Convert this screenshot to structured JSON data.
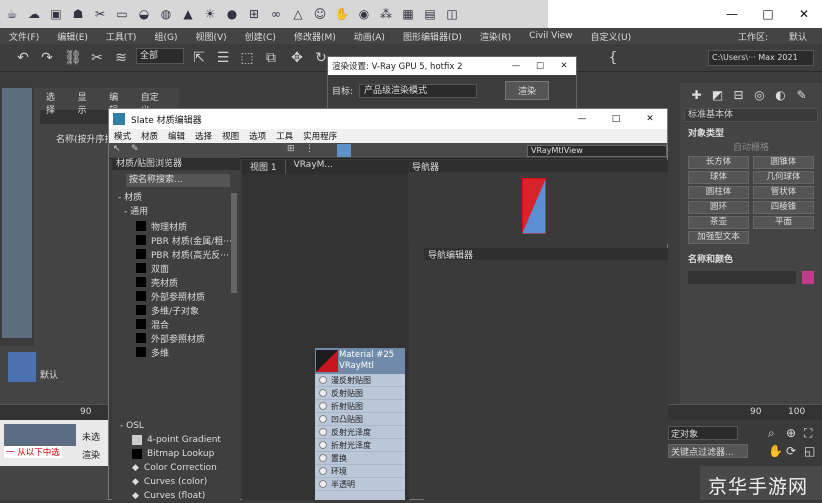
{
  "window": {
    "title": "工作区: 默认",
    "min": "—",
    "max": "□",
    "close": "✕"
  },
  "menu": [
    "文件(F)",
    "编辑(E)",
    "工具(T)",
    "组(G)",
    "视图(V)",
    "创建(C)",
    "修改器(M)",
    "动画(A)",
    "图形编辑器(D)",
    "渲染(R)",
    "Civil View",
    "自定义(U)"
  ],
  "workspace": {
    "label": "工作区:",
    "value": "默认",
    "path": "C:\\Users\\··· Max 2021"
  },
  "toolbar": {
    "filter": "全部",
    "brace": "{"
  },
  "left_panel": {
    "tabs": [
      "选择",
      "显示",
      "编辑",
      "自定义"
    ],
    "name_col": "名称(按升序排",
    "default": "默认"
  },
  "render_dialog": {
    "title": "渲染设置: V-Ray GPU 5, hotfix 2",
    "target_label": "目标:",
    "target_value": "产品级渲染模式",
    "render_btn": "渲染"
  },
  "slate": {
    "title": "Slate 材质编辑器",
    "menu": [
      "模式",
      "材质",
      "编辑",
      "选择",
      "视图",
      "选项",
      "工具",
      "实用程序"
    ],
    "view_select": "VRayMtlView"
  },
  "browser": {
    "title": "材质/贴图浏览器",
    "search": "按名称搜索...",
    "cat_material": "- 材质",
    "cat_general": "- 通用",
    "items": [
      "物理材质",
      "PBR 材质(金属/粗···",
      "PBR 材质(高光反···",
      "双面",
      "壳材质",
      "外部参照材质",
      "多维/子对象",
      "混合",
      "外部参照材质",
      "多维"
    ],
    "osl": "- OSL",
    "osl_items": [
      "4-point Gradient",
      "Bitmap Lookup",
      "Color Correction",
      "Curves (color)",
      "Curves (float)"
    ]
  },
  "view_tabs": [
    "视图 1",
    "VRayM..."
  ],
  "navigator": {
    "title": "导航器"
  },
  "param_editor": {
    "title": "导航编辑器"
  },
  "node": {
    "title": "Material #25",
    "sub": "VRayMtl",
    "rows": [
      "漫反射贴图",
      "反射贴图",
      "折射贴图",
      "凹凸贴图",
      "反射光泽度",
      "折射光泽度",
      "置换",
      "环境",
      "半透明"
    ]
  },
  "right_panel": {
    "section": "标准基本体",
    "obj_type": "对象类型",
    "auto_grid": "自动栅格",
    "buttons": [
      "长方体",
      "圆锥体",
      "球体",
      "几何球体",
      "圆柱体",
      "管状体",
      "圆环",
      "四棱锥",
      "茶壶",
      "平面",
      "加强型文本"
    ],
    "name_color": "名称和颜色",
    "accent": "#c23a8b"
  },
  "timeline": {
    "left_ticks": [
      "90"
    ],
    "right_ticks": [
      "90",
      "100"
    ],
    "slider": "0"
  },
  "status": {
    "mode": "未选",
    "warn": "一  从以下中选",
    "render": "渲染"
  },
  "bottom_right": {
    "filter": "定对象",
    "add": "关键点过滤器..."
  },
  "watermark": "京华手游网"
}
